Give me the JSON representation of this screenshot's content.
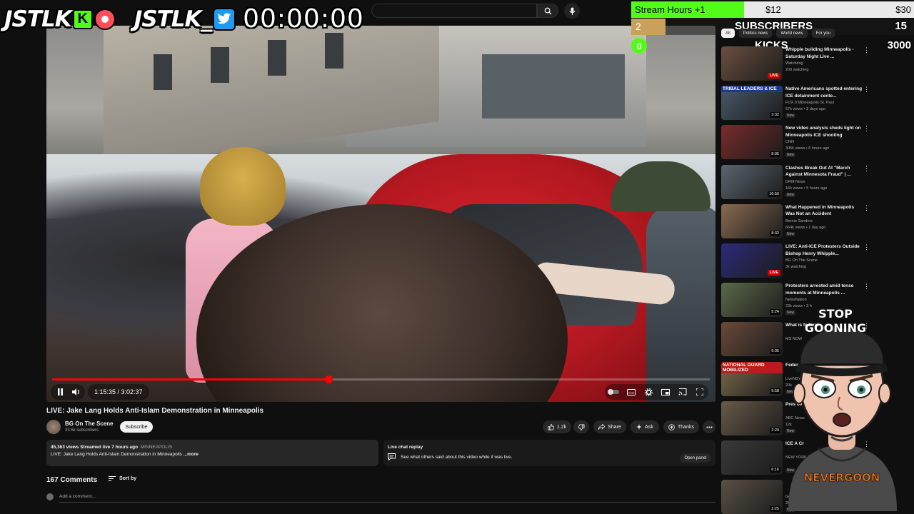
{
  "overlay": {
    "brand_left": "JSTLK",
    "kick_letter": "K",
    "brand_right": "JSTLK_",
    "timer": "00:00:00",
    "stream_hours_label": "Stream Hours +1",
    "stream_hours_fill": 0.4,
    "stream_hours_mid": "$12",
    "stream_hours_end": "$30",
    "subscribers_label": "SUBSCRIBERS",
    "subscribers_count": "2",
    "subscribers_goal": "15",
    "kicks_label": "KICKS",
    "kicks_count": "0",
    "kicks_goal": "3000",
    "mascot_sign": [
      "STOP",
      "GOONING"
    ],
    "mascot_shirt": "NEVERGOON"
  },
  "player": {
    "progress": 0.42,
    "time_display": "1:15:35 / 3:02:37"
  },
  "video": {
    "title": "LIVE: Jake Lang Holds Anti-Islam Demonstration in Minneapolis",
    "channel": "BG On The Scene",
    "channel_subs": "33.5k subscribers",
    "subscribe_label": "Subscribe",
    "likes": "1.2k",
    "share_label": "Share",
    "ask_label": "Ask",
    "thanks_label": "Thanks"
  },
  "description": {
    "stats": "45,363 views  Streamed live 7 hours ago",
    "location": "MINNEAPOLIS",
    "text": "LIVE: Jake Lang Holds Anti-Islam Demonstration in Minneapolis",
    "more": "...more"
  },
  "chat_replay": {
    "title": "Live chat replay",
    "subtitle": "See what others said about this video while it was live.",
    "button": "Open panel"
  },
  "comments": {
    "count_label": "167 Comments",
    "sort_label": "Sort by",
    "add_placeholder": "Add a comment..."
  },
  "rail": {
    "chips": [
      "All",
      "Politics news",
      "World news",
      "For you"
    ],
    "items": [
      {
        "title": "Whipple building Minneapolis - Saturday Night Live ...",
        "channel": "Watchdog",
        "meta": "209 watching",
        "badge": "LIVE",
        "new": "",
        "thumb": "#6b4f40",
        "banner": ""
      },
      {
        "title": "Native Americans spotted entering ICE detainment cente...",
        "channel": "FOX 9 Minneapolis-St. Paul",
        "meta": "57k views • 2 days ago",
        "badge": "3:32",
        "new": "New",
        "thumb": "#4a5a6a",
        "banner": "TRIBAL LEADERS & ICE"
      },
      {
        "title": "New video analysis sheds light on Minneapolis ICE shooting",
        "channel": "CNN",
        "meta": "305k views • 6 hours ago",
        "badge": "8:05",
        "new": "New",
        "thumb": "#7a2b2b",
        "banner": ""
      },
      {
        "title": "Clashes Break Out At \"March Against Minnesota Fraud\" | ...",
        "channel": "DRM News",
        "meta": "16k views • 5 hours ago",
        "badge": "16:56",
        "new": "New",
        "thumb": "#5b6670",
        "banner": ""
      },
      {
        "title": "What Happened in Minneapolis Was Not an Accident",
        "channel": "Bernie Sanders",
        "meta": "664k views • 1 day ago",
        "badge": "8:32",
        "new": "New",
        "thumb": "#8a6b52",
        "banner": ""
      },
      {
        "title": "LIVE: Anti-ICE Protesters Outside Bishop Henry Whipple...",
        "channel": "BG On The Scene",
        "meta": "3k watching",
        "badge": "LIVE",
        "new": "",
        "thumb": "#2c2a7a",
        "banner": ""
      },
      {
        "title": "Protesters arrested amid tense moments at Minneapolis ...",
        "channel": "NewsNation",
        "meta": "23k views • 3 h",
        "badge": "5:24",
        "new": "New",
        "thumb": "#5c6a4a",
        "banner": ""
      },
      {
        "title": "What is federal",
        "channel": "MS NOW",
        "meta": "",
        "badge": "9:05",
        "new": "",
        "thumb": "#6a4a3a",
        "banner": ""
      },
      {
        "title": "Federal agent",
        "channel": "LiveNOW",
        "meta": "20k",
        "badge": "9:58",
        "new": "New",
        "thumb": "#7a6a4a",
        "banner": "NATIONAL GUARD MOBILIZED"
      },
      {
        "title": "Pres over G",
        "channel": "ABC News",
        "meta": "12k",
        "badge": "2:20",
        "new": "New",
        "thumb": "#6a5a4a",
        "banner": ""
      },
      {
        "title": "ICE A Cr",
        "channel": "NEW YORK POST",
        "meta": "",
        "badge": "6:16",
        "new": "New",
        "thumb": "#3a3a3a",
        "banner": ""
      },
      {
        "title": "",
        "channel": "Good",
        "meta": "26k views • 10 hours ago",
        "badge": "2:25",
        "new": "New",
        "thumb": "#5a5045",
        "banner": ""
      }
    ]
  },
  "colors": {
    "accent_red": "#ff0000",
    "kick_green": "#53fc18",
    "background": "#0f0f0f"
  }
}
